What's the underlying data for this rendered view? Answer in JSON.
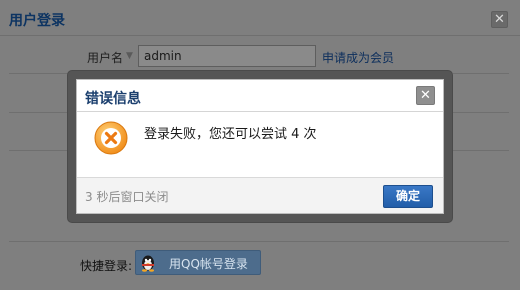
{
  "login": {
    "title": "用户登录",
    "close_glyph": "✕",
    "username_label": "用户名",
    "username_value": "admin",
    "register_link": "申请成为会员",
    "quick_login_label": "快捷登录:",
    "qq_button_label": "用QQ帐号登录"
  },
  "dialog": {
    "title": "错误信息",
    "close_glyph": "✕",
    "message": "登录失败，您还可以尝试 4 次",
    "auto_close_text": "3 秒后窗口关闭",
    "confirm_label": "确定"
  },
  "colors": {
    "dialog_title": "#1b3f6e",
    "confirm_button": "#2a68b6",
    "error_icon": "#f5a623"
  },
  "icons": {
    "error": "error-x-icon",
    "qq": "qq-penguin-icon",
    "dropdown": "chevron-down-icon"
  }
}
